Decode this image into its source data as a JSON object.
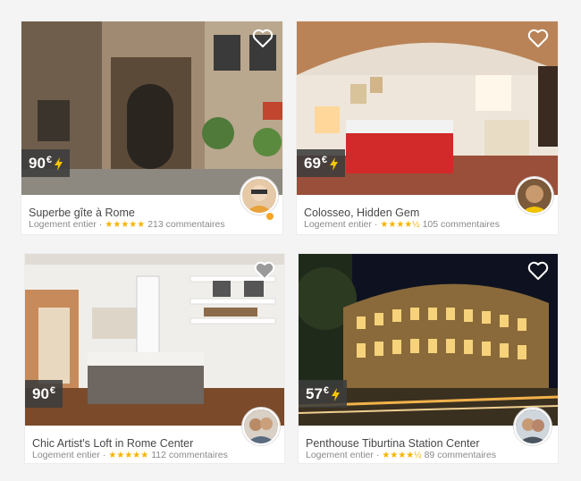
{
  "listings": [
    {
      "title": "Superbe gîte à Rome",
      "type": "Logement entier",
      "price": "90",
      "currency": "€",
      "instant_book": true,
      "rating": 5,
      "reviews": "213 commentaires",
      "stars": "★★★★★"
    },
    {
      "title": "Colosseo, Hidden Gem",
      "type": "Logement entier",
      "price": "69",
      "currency": "€",
      "instant_book": true,
      "rating": 4.5,
      "reviews": "105 commentaires",
      "stars": "★★★★½"
    },
    {
      "title": "Chic Artist's Loft in Rome Center",
      "type": "Logement entier",
      "price": "90",
      "currency": "€",
      "instant_book": false,
      "rating": 5,
      "reviews": "112 commentaires",
      "stars": "★★★★★"
    },
    {
      "title": "Penthouse Tiburtina Station Center",
      "type": "Logement entier",
      "price": "57",
      "currency": "€",
      "instant_book": true,
      "rating": 4.5,
      "reviews": "89 commentaires",
      "stars": "★★★★½"
    }
  ],
  "separator": "·",
  "icons": [
    "heart-icon",
    "lightning-bolt-icon",
    "star-icon"
  ],
  "colors": {
    "stars": "#f5b400",
    "bolt": "#f5c400",
    "superhost": "#f5a623"
  }
}
